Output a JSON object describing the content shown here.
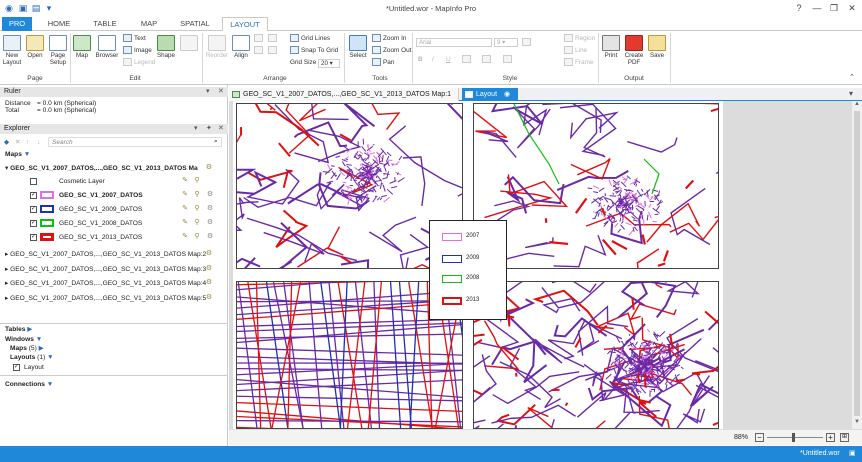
{
  "window": {
    "title": "*Untitled.wor - MapInfo Pro",
    "controls": [
      "?",
      "—",
      "❐",
      "✕"
    ]
  },
  "tabs": [
    {
      "label": "PRO"
    },
    {
      "label": "HOME"
    },
    {
      "label": "TABLE"
    },
    {
      "label": "MAP"
    },
    {
      "label": "SPATIAL"
    },
    {
      "label": "LAYOUT"
    }
  ],
  "ribbon": {
    "page": {
      "new": "New Layout",
      "open": "Open",
      "setup": "Page Setup",
      "label": "Page"
    },
    "edit": {
      "map": "Map",
      "browser": "Browser",
      "legend": "Legend",
      "text": "Text",
      "image": "Image",
      "shape": "Shape",
      "label": "Edit"
    },
    "arrange": {
      "reorder": "Reorder",
      "align": "Align",
      "grid_lines": "Grid Lines",
      "snap": "Snap To Grid",
      "grid_size_label": "Grid Size",
      "grid_size_value": "20",
      "label": "Arrange"
    },
    "tools": {
      "select": "Select",
      "zoom_in": "Zoom In",
      "zoom_out": "Zoom Out",
      "pan": "Pan",
      "label": "Tools"
    },
    "style": {
      "font": "Arial",
      "size": "9",
      "bold": "B",
      "italic": "I",
      "underline": "U",
      "region": "Region",
      "line": "Line",
      "frame": "Frame",
      "label": "Style"
    },
    "output": {
      "print": "Print",
      "create": "Create PDF",
      "save": "Save",
      "label": "Output"
    }
  },
  "ruler": {
    "title": "Ruler",
    "distance_label": "Distance",
    "distance_value": "= 0.0 km (Spherical)",
    "total_label": "Total",
    "total_value": "= 0.0 km (Spherical)"
  },
  "explorer": {
    "title": "Explorer",
    "search_placeholder": "Search",
    "maps_header": "Maps",
    "map_groups": [
      "GEO_SC_V1_2007_DATOS,...,GEO_SC_V1_2013_DATOS Ma",
      "GEO_SC_V1_2007_DATOS,...,GEO_SC_V1_2013_DATOS Map:2",
      "GEO_SC_V1_2007_DATOS,...,GEO_SC_V1_2013_DATOS Map:3",
      "GEO_SC_V1_2007_DATOS,...,GEO_SC_V1_2013_DATOS Map:4",
      "GEO_SC_V1_2007_DATOS,...,GEO_SC_V1_2013_DATOS Map:5"
    ],
    "layers": [
      {
        "name": "Cosmetic Layer",
        "color": ""
      },
      {
        "name": "GEO_SC_V1_2007_DATOS",
        "color": "#e070e0"
      },
      {
        "name": "GEO_SC_V1_2009_DATOS",
        "color": "#2030b0"
      },
      {
        "name": "GEO_SC_V1_2008_DATOS",
        "color": "#10c010"
      },
      {
        "name": "GEO_SC_V1_2013_DATOS",
        "color": "#e01010"
      }
    ],
    "tables": "Tables",
    "windows": "Windows",
    "maps_count": "Maps",
    "maps_count_value": "(5)",
    "layouts": "Layouts",
    "layouts_count": "(1)",
    "layout_item": "Layout",
    "connections": "Connections"
  },
  "doc_tabs": [
    {
      "label": "GEO_SC_V1_2007_DATOS,...,GEO_SC_V1_2013_DATOS Map:1"
    },
    {
      "label": "Layout"
    }
  ],
  "legend": [
    {
      "year": "2007",
      "color": "#e070e0"
    },
    {
      "year": "2009",
      "color": "#2030b0"
    },
    {
      "year": "2008",
      "color": "#10c010"
    },
    {
      "year": "2013",
      "color": "#e01010"
    }
  ],
  "zoom": {
    "level": "88%"
  },
  "status": {
    "file": "*Untitled.wor"
  }
}
